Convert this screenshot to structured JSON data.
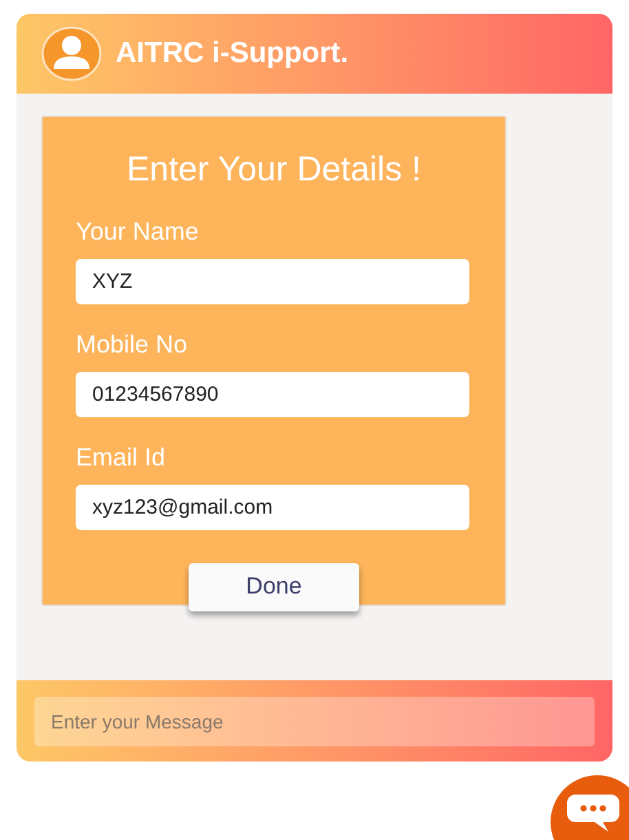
{
  "header": {
    "title": "AITRC i-Support."
  },
  "form": {
    "title": "Enter Your Details !",
    "fields": [
      {
        "label": "Your Name",
        "value": "XYZ"
      },
      {
        "label": "Mobile No",
        "value": "01234567890"
      },
      {
        "label": "Email Id",
        "value": "xyz123@gmail.com"
      }
    ],
    "button": "Done"
  },
  "message": {
    "placeholder": "Enter your Message"
  }
}
